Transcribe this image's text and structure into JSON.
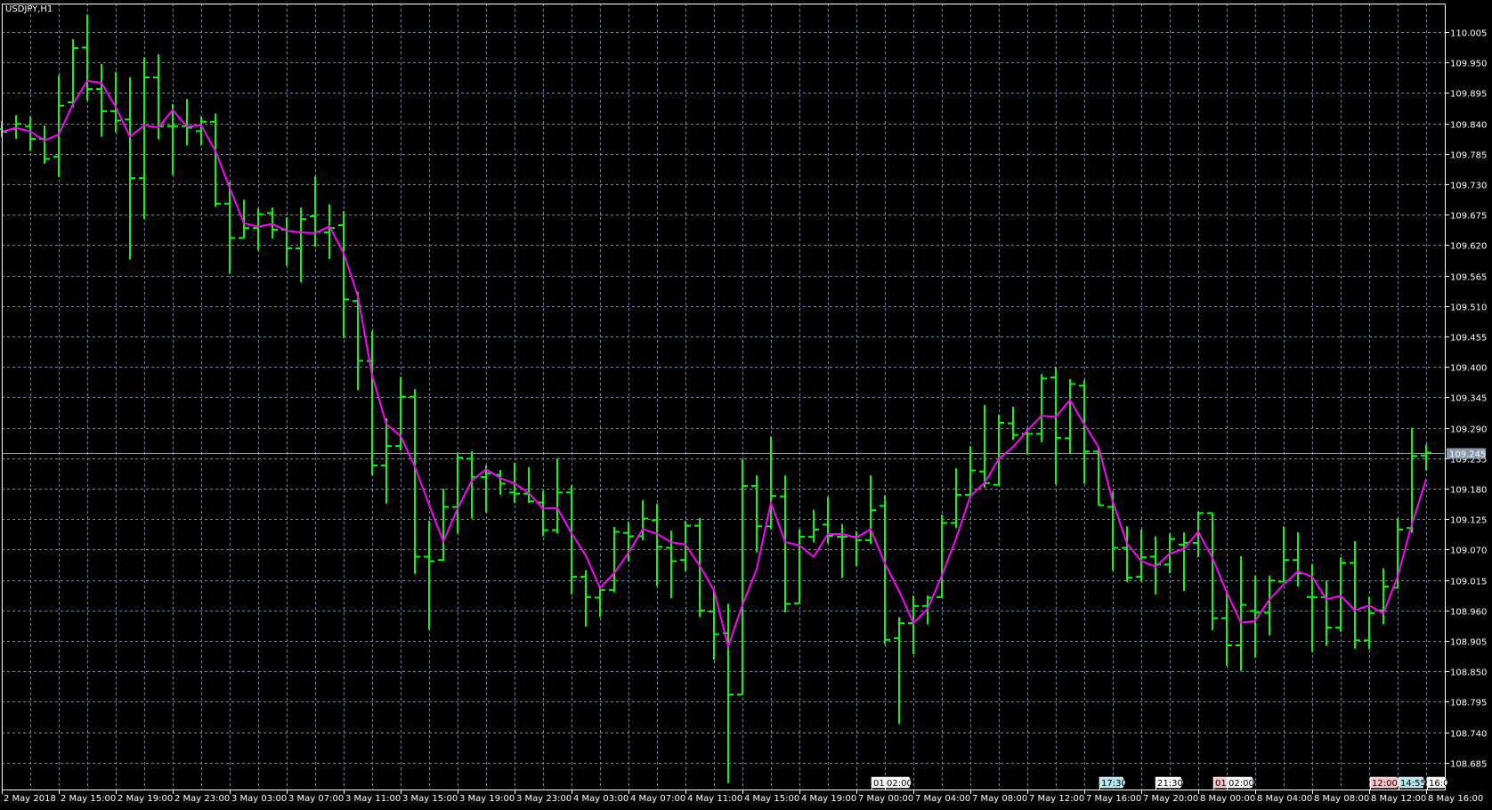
{
  "window": {
    "title": "USDJPY,H1"
  },
  "colors": {
    "background": "#000000",
    "bars": "#00ff00",
    "moving_average": "#ff00ff",
    "grid": "#778899",
    "axis": "#ffffff",
    "price_line": "#8898a8",
    "price_label_bg": "#8898a8"
  },
  "current_price": {
    "value": 109.245,
    "label": "109.245"
  },
  "event_markers": [
    {
      "text": "01:",
      "color": "#ffffff"
    },
    {
      "text": "02:00",
      "color": "#ffffff"
    },
    {
      "text": "17:30",
      "color": "#b0e8f0"
    },
    {
      "text": "21:30",
      "color": "#ffffff"
    },
    {
      "text": "01:",
      "color": "#ffc0cb"
    },
    {
      "text": "02:00",
      "color": "#ffffff"
    },
    {
      "text": "12:00",
      "color": "#ffc0cb"
    },
    {
      "text": "14:55",
      "color": "#b0e8f0"
    },
    {
      "text": "16:0",
      "color": "#ffffff"
    }
  ],
  "chart_data": {
    "type": "bar",
    "bar_style": "ohlc",
    "title": "USDJPY,H1",
    "symbol": "USDJPY",
    "timeframe": "H1",
    "ylim": [
      108.66,
      110.06
    ],
    "y_ticks": [
      "110.005",
      "109.950",
      "109.895",
      "109.840",
      "109.785",
      "109.730",
      "109.675",
      "109.620",
      "109.565",
      "109.510",
      "109.455",
      "109.400",
      "109.345",
      "109.290",
      "109.235",
      "109.180",
      "109.125",
      "109.070",
      "109.015",
      "108.960",
      "108.905",
      "108.850",
      "108.795",
      "108.740",
      "108.685"
    ],
    "x_ticks": [
      "2 May 2018",
      "2 May 15:00",
      "2 May 19:00",
      "2 May 23:00",
      "3 May 03:00",
      "3 May 07:00",
      "3 May 11:00",
      "3 May 15:00",
      "3 May 19:00",
      "3 May 23:00",
      "4 May 03:00",
      "4 May 07:00",
      "4 May 11:00",
      "4 May 15:00",
      "4 May 19:00",
      "7 May 00:00",
      "7 May 04:00",
      "7 May 08:00",
      "7 May 12:00",
      "7 May 16:00",
      "7 May 20:00",
      "8 May 00:00",
      "8 May 04:00",
      "8 May 08:00",
      "8 May 12:00",
      "8 May 16:00"
    ],
    "grid": true,
    "series": [
      {
        "name": "USDJPY OHLC",
        "ohlc": [
          [
            109.83,
            109.845,
            109.815,
            109.825
          ],
          [
            109.83,
            109.855,
            109.812,
            109.839
          ],
          [
            109.835,
            109.852,
            109.79,
            109.812
          ],
          [
            109.812,
            109.836,
            109.767,
            109.776
          ],
          [
            109.78,
            109.927,
            109.743,
            109.872
          ],
          [
            109.878,
            109.992,
            109.869,
            109.976
          ],
          [
            109.977,
            110.036,
            109.881,
            109.902
          ],
          [
            109.902,
            109.947,
            109.816,
            109.862
          ],
          [
            109.862,
            109.933,
            109.824,
            109.845
          ],
          [
            109.847,
            109.923,
            109.594,
            109.741
          ],
          [
            109.741,
            109.959,
            109.667,
            109.923
          ],
          [
            109.923,
            109.965,
            109.811,
            109.835
          ],
          [
            109.835,
            109.875,
            109.747,
            109.835
          ],
          [
            109.835,
            109.884,
            109.8,
            109.832
          ],
          [
            109.826,
            109.852,
            109.8,
            109.843
          ],
          [
            109.843,
            109.858,
            109.689,
            109.695
          ],
          [
            109.695,
            109.734,
            109.568,
            109.633
          ],
          [
            109.633,
            109.702,
            109.632,
            109.651
          ],
          [
            109.651,
            109.686,
            109.611,
            109.676
          ],
          [
            109.678,
            109.688,
            109.632,
            109.648
          ],
          [
            109.648,
            109.67,
            109.583,
            109.614
          ],
          [
            109.614,
            109.688,
            109.553,
            109.667
          ],
          [
            109.672,
            109.744,
            109.617,
            109.644
          ],
          [
            109.643,
            109.694,
            109.595,
            109.651
          ],
          [
            109.656,
            109.682,
            109.452,
            109.522
          ],
          [
            109.519,
            109.536,
            109.358,
            109.411
          ],
          [
            109.411,
            109.465,
            109.204,
            109.222
          ],
          [
            109.222,
            109.307,
            109.153,
            109.257
          ],
          [
            109.257,
            109.382,
            109.249,
            109.346
          ],
          [
            109.346,
            109.36,
            109.026,
            109.057
          ],
          [
            109.057,
            109.122,
            108.925,
            109.049
          ],
          [
            109.051,
            109.18,
            109.049,
            109.147
          ],
          [
            109.147,
            109.245,
            109.099,
            109.236
          ],
          [
            109.234,
            109.248,
            109.126,
            109.201
          ],
          [
            109.201,
            109.222,
            109.137,
            109.208
          ],
          [
            109.205,
            109.214,
            109.169,
            109.189
          ],
          [
            109.173,
            109.227,
            109.154,
            109.171
          ],
          [
            109.171,
            109.219,
            109.154,
            109.157
          ],
          [
            109.155,
            109.176,
            109.094,
            109.105
          ],
          [
            109.105,
            109.235,
            109.099,
            109.173
          ],
          [
            109.173,
            109.186,
            108.989,
            109.021
          ],
          [
            109.021,
            109.033,
            108.931,
            108.984
          ],
          [
            108.983,
            109.003,
            108.948,
            108.997
          ],
          [
            108.997,
            109.111,
            108.993,
            109.102
          ],
          [
            109.1,
            109.12,
            109.049,
            109.094
          ],
          [
            109.094,
            109.159,
            109.087,
            109.126
          ],
          [
            109.123,
            109.153,
            109.004,
            109.075
          ],
          [
            109.073,
            109.104,
            108.982,
            109.049
          ],
          [
            109.051,
            109.122,
            109.031,
            109.113
          ],
          [
            109.113,
            109.127,
            108.948,
            108.96
          ],
          [
            108.958,
            108.999,
            108.871,
            108.917
          ],
          [
            108.919,
            108.972,
            108.648,
            108.808
          ],
          [
            108.808,
            109.233,
            108.808,
            109.185
          ],
          [
            109.185,
            109.204,
            109.065,
            109.112
          ],
          [
            109.112,
            109.274,
            109.107,
            109.167
          ],
          [
            109.166,
            109.204,
            108.956,
            108.972
          ],
          [
            108.973,
            109.106,
            108.973,
            109.093
          ],
          [
            109.093,
            109.142,
            109.083,
            109.106
          ],
          [
            109.115,
            109.165,
            109.081,
            109.095
          ],
          [
            109.093,
            109.116,
            109.019,
            109.093
          ],
          [
            109.093,
            109.103,
            109.04,
            109.087
          ],
          [
            109.087,
            109.204,
            109.08,
            109.141
          ],
          [
            109.149,
            109.168,
            108.899,
            108.907
          ],
          [
            108.91,
            108.948,
            108.755,
            108.937
          ],
          [
            108.937,
            108.987,
            108.881,
            108.968
          ],
          [
            108.968,
            108.987,
            108.935,
            108.983
          ],
          [
            108.984,
            109.133,
            108.984,
            109.118
          ],
          [
            109.118,
            109.217,
            109.109,
            109.169
          ],
          [
            109.169,
            109.257,
            109.162,
            109.213
          ],
          [
            109.211,
            109.331,
            109.182,
            109.19
          ],
          [
            109.187,
            109.314,
            109.187,
            109.299
          ],
          [
            109.298,
            109.328,
            109.268,
            109.277
          ],
          [
            109.279,
            109.29,
            109.242,
            109.279
          ],
          [
            109.279,
            109.387,
            109.264,
            109.379
          ],
          [
            109.381,
            109.4,
            109.188,
            109.272
          ],
          [
            109.271,
            109.378,
            109.244,
            109.369
          ],
          [
            109.366,
            109.376,
            109.189,
            109.247
          ],
          [
            109.247,
            109.256,
            109.15,
            109.15
          ],
          [
            109.147,
            109.174,
            109.032,
            109.073
          ],
          [
            109.073,
            109.112,
            109.011,
            109.019
          ],
          [
            109.021,
            109.106,
            109.012,
            109.056
          ],
          [
            109.057,
            109.094,
            108.989,
            109.043
          ],
          [
            109.043,
            109.099,
            109.027,
            109.089
          ],
          [
            109.079,
            109.101,
            108.995,
            109.082
          ],
          [
            109.082,
            109.139,
            109.056,
            109.136
          ],
          [
            109.136,
            109.136,
            108.924,
            108.946
          ],
          [
            108.946,
            108.997,
            108.86,
            108.897
          ],
          [
            108.897,
            109.058,
            108.851,
            108.97
          ],
          [
            108.959,
            109.023,
            108.875,
            108.956
          ],
          [
            108.956,
            109.023,
            108.915,
            109.014
          ],
          [
            109.012,
            109.112,
            109.012,
            109.051
          ],
          [
            109.051,
            109.101,
            109.003,
            109.027
          ],
          [
            108.984,
            109.044,
            108.885,
            108.984
          ],
          [
            108.984,
            109.014,
            108.896,
            108.929
          ],
          [
            108.929,
            109.056,
            108.921,
            109.046
          ],
          [
            109.046,
            109.085,
            108.891,
            108.906
          ],
          [
            108.906,
            108.985,
            108.89,
            108.955
          ],
          [
            108.96,
            109.036,
            108.935,
            109.003
          ],
          [
            109.001,
            109.127,
            109.0,
            109.106
          ],
          [
            109.109,
            109.29,
            109.1,
            109.239
          ],
          [
            109.24,
            109.26,
            109.213,
            109.245
          ]
        ]
      },
      {
        "name": "Moving Average",
        "type": "line"
      }
    ]
  }
}
